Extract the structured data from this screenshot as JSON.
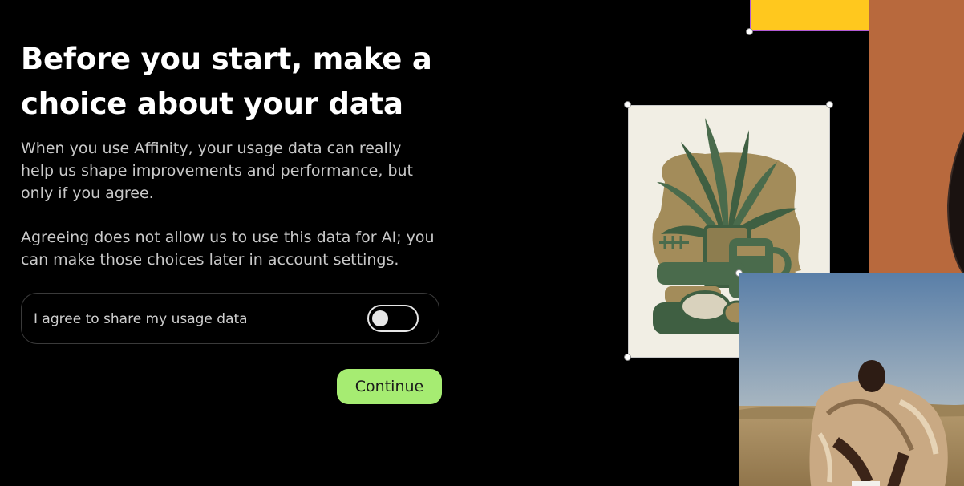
{
  "onboarding": {
    "title": "Before you start, make a choice about your data",
    "paragraph_1": "When you use Affinity, your usage data can really help us shape improvements and performance, but only if you agree.",
    "paragraph_2": "Agreeing does not allow us to use this data for AI; you can make those choices later in account settings.",
    "consent": {
      "label": "I agree to share my usage data",
      "enabled": false
    },
    "continue_label": "Continue"
  },
  "theme": {
    "background": "#000000",
    "accent_button": "#a6ec72",
    "selection_color": "#b15ad4",
    "yellow": "#ffc81e",
    "orange": "#b8693d"
  },
  "artwork": {
    "poster_icon": "botanical-vase-illustration",
    "photo_icon": "person-in-fur-coat-photo"
  }
}
